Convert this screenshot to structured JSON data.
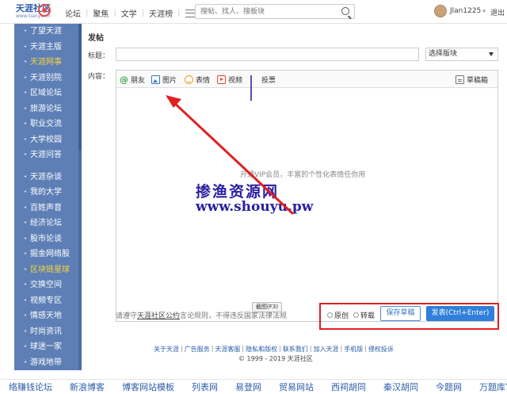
{
  "header": {
    "logo_main": "天涯社区",
    "logo_sub": "www.tianya.cn",
    "nav": [
      "论坛",
      "聚焦",
      "文学",
      "天涯榜"
    ],
    "search_placeholder": "搜帖、找人、搜板块",
    "username": "Jlan1225",
    "logout": "退出"
  },
  "sidebar": {
    "group1": [
      "了望天涯",
      "天涯主版",
      "天涯网事",
      "天涯别院",
      "区域论坛",
      "旅游论坛",
      "职业交流",
      "大学校园",
      "天涯问答"
    ],
    "group2": [
      "天涯杂谈",
      "我的大学",
      "百姓声音",
      "经济论坛",
      "股市论谈",
      "掘金网络股",
      "区块链星球",
      "交换空间",
      "视频专区",
      "情感天地",
      "时尚资讯",
      "球迷一家",
      "游戏地带"
    ],
    "active": [
      "天涯网事",
      "区块链星球"
    ]
  },
  "main": {
    "heading": "发帖",
    "title_label": "标题：",
    "content_label": "内容：",
    "board_select": "选择版块",
    "toolbar": {
      "friend": "朋友",
      "picture": "图片",
      "emoji": "表情",
      "video": "视频",
      "vote": "投票",
      "drafts": "草稿箱"
    },
    "vip_hint": "开通VIP会员，丰富的个性化表情任你用",
    "watermark_cn": "掺渔资源网",
    "watermark_url": "www.shouyu.pw",
    "screenshot_btn": "截图(F3)",
    "agreement_pre": "请遵守",
    "agreement_link": "天涯社区公约",
    "agreement_post": "言论规则，不得违反国家法律法规",
    "radio_original": "原创",
    "radio_repost": "转载",
    "save_draft": "保存草稿",
    "post_btn": "发表(Ctrl+Enter)"
  },
  "footer": {
    "links": [
      "关于天涯",
      "广告服务",
      "天涯客服",
      "隐私和版权",
      "联系我们",
      "加入天涯",
      "手机版",
      "侵权投诉"
    ],
    "copyright": "© 1999 - 2019 天涯社区"
  },
  "bottom_strip": [
    "络赚钱论坛",
    "新浪博客",
    "博客网站模板",
    "列表网",
    "易登网",
    "贸易网站",
    "西祠胡同",
    "秦汉胡同",
    "今题网",
    "万题库官"
  ],
  "colors": {
    "sidebar_bg": "#5e7fb6",
    "active_item": "#f5d53b",
    "primary_button": "#2f7fdb",
    "annotation_red": "#e02020"
  }
}
